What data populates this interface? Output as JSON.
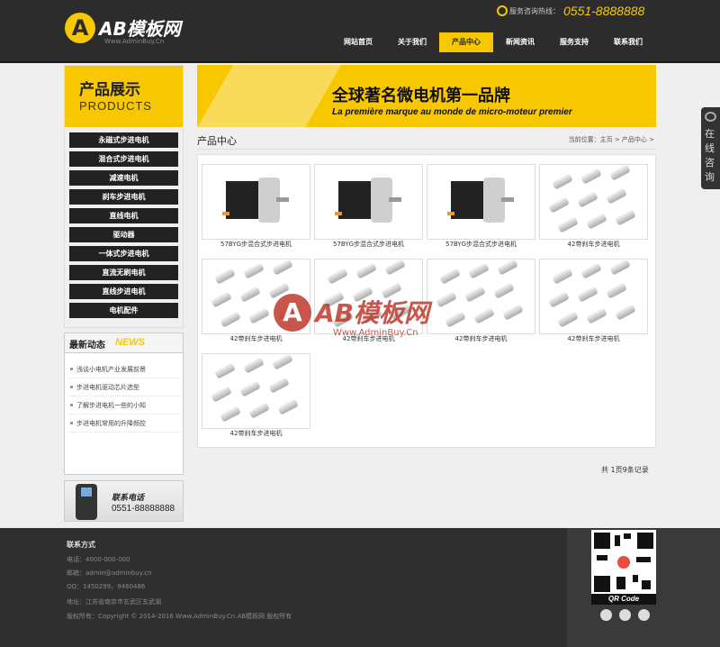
{
  "header": {
    "logo_mark": "A",
    "logo_text": "AB模板网",
    "logo_site": "Www.AdminBuy.Cn",
    "hotline_label": "服务咨询热线：",
    "hotline_number": "0551-8888888",
    "nav": [
      "网站首页",
      "关于我们",
      "产品中心",
      "新闻资讯",
      "服务支持",
      "联系我们"
    ],
    "active_nav": "产品中心"
  },
  "sidebar": {
    "products_title_zh": "产品展示",
    "products_title_en": "PRODUCTS",
    "categories": [
      "永磁式步进电机",
      "混合式步进电机",
      "减速电机",
      "刹车步进电机",
      "直线电机",
      "驱动器",
      "一体式步进电机",
      "直流无刷电机",
      "直线步进电机",
      "电机配件"
    ],
    "news_title_zh": "最新动态",
    "news_title_en": "NEWS",
    "news": [
      "浅谈小电机产业发展前景",
      "步进电机驱动芯片选型",
      "了解步进电机一些的小知",
      "步进电机常用的升降频控"
    ],
    "contact_title": "联系电话",
    "contact_phone": "0551-88888888"
  },
  "banner": {
    "title": "全球著名微电机第一品牌",
    "subtitle": "La première marque au monde de micro-moteur premier"
  },
  "section": {
    "title": "产品中心",
    "breadcrumb": "当前位置：主页 > 产品中心 >"
  },
  "products": [
    {
      "name": "57BYG步混合式步进电机",
      "image": "stepper-motor"
    },
    {
      "name": "57BYG步混合式步进电机",
      "image": "stepper-motor"
    },
    {
      "name": "57BYG步混合式步进电机",
      "image": "stepper-motor"
    },
    {
      "name": "42带刹车步进电机",
      "image": "cylinder-motors"
    },
    {
      "name": "42带刹车步进电机",
      "image": "cylinder-motors"
    },
    {
      "name": "42带刹车步进电机",
      "image": "cylinder-motors"
    },
    {
      "name": "42带刹车步进电机",
      "image": "cylinder-motors"
    },
    {
      "name": "42带刹车步进电机",
      "image": "cylinder-motors"
    },
    {
      "name": "42带刹车步进电机",
      "image": "cylinder-motors"
    }
  ],
  "pager_text": "共 1页9条记录",
  "float_consult": "在线咨询",
  "watermark": {
    "mark": "A",
    "text": "AB模板网",
    "site": "Www.AdminBuy.Cn"
  },
  "footer": {
    "title": "联系方式",
    "lines": [
      "电话：4000-000-000",
      "邮箱：admin@adminbuy.cn",
      "QQ：1450299，9460486",
      "地址：江苏省南京市玄武区玄武湖",
      "版权所有：Copyright © 2014-2016 Www.AdminBuy.Cn AB模板网 版权所有"
    ],
    "qr_label": "QR Code"
  },
  "colors": {
    "accent": "#f7c800",
    "dark": "#2c2c2c",
    "watermark": "#c0392b"
  }
}
